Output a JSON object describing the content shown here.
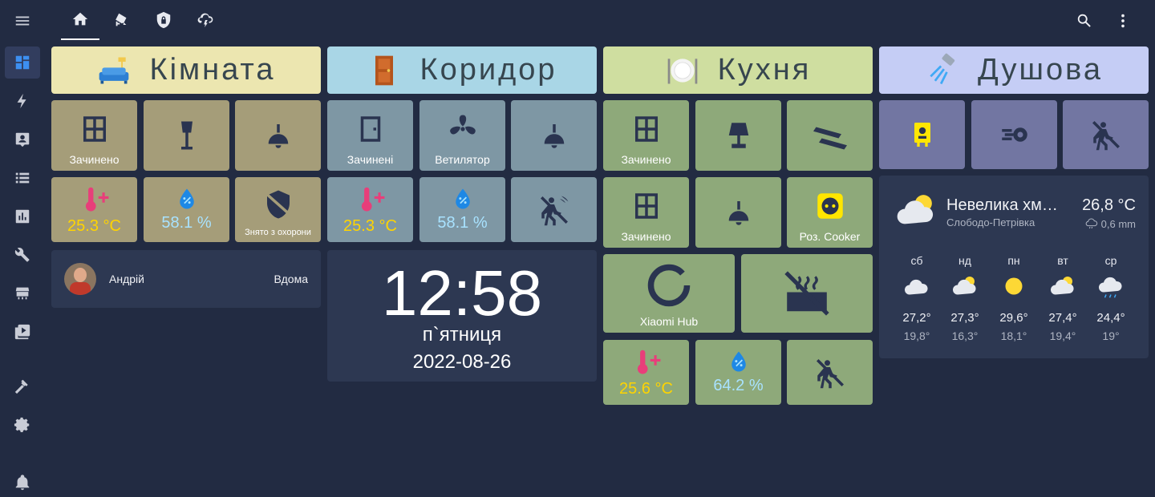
{
  "rooms": [
    {
      "name": "Кімната"
    },
    {
      "name": "Коридор"
    },
    {
      "name": "Кухня"
    },
    {
      "name": "Душова"
    }
  ],
  "kimnata": {
    "window_state": "Зачинено",
    "temperature": "25.3 °C",
    "humidity": "58.1 %",
    "alarm_state": "Знято з охорони"
  },
  "korydor": {
    "door_state": "Зачинені",
    "fan_label": "Ветилятор",
    "temperature": "25.3 °C",
    "humidity": "58.1 %"
  },
  "kukhnia": {
    "window1_state": "Зачинено",
    "window2_state": "Зачинено",
    "socket_label": "Роз. Cooker",
    "hub_label": "Xiaomi Hub",
    "temperature": "25.6 °C",
    "humidity": "64.2 %"
  },
  "person": {
    "name": "Андрій",
    "state": "Вдома"
  },
  "clock": {
    "time": "12:58",
    "day": "п`ятниця",
    "date": "2022-08-26"
  },
  "weather": {
    "condition": "Невелика хм…",
    "location": "Слободо-Петрівка",
    "temperature": "26,8 °C",
    "precipitation": "0,6 mm",
    "forecast": [
      {
        "day": "сб",
        "icon": "cloudy-icon",
        "high": "27,2°",
        "low": "19,8°"
      },
      {
        "day": "нд",
        "icon": "partly-cloudy-icon",
        "high": "27,3°",
        "low": "16,3°"
      },
      {
        "day": "пн",
        "icon": "sunny-icon",
        "high": "29,6°",
        "low": "18,1°"
      },
      {
        "day": "вт",
        "icon": "partly-cloudy-icon",
        "high": "27,4°",
        "low": "19,4°"
      },
      {
        "day": "ср",
        "icon": "rainy-icon",
        "high": "24,4°",
        "low": "19°"
      }
    ]
  },
  "colors": {
    "kimnata": "#a59d79",
    "korydor": "#7e97a4",
    "kukhnia": "#8ea97a",
    "dushova": "#7276a2",
    "accent": "#3d8ff0"
  }
}
